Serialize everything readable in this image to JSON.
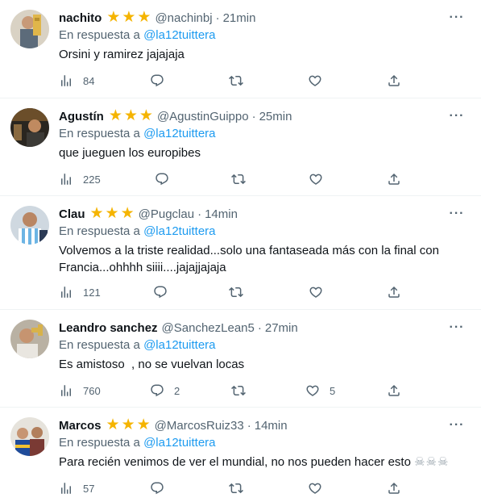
{
  "tweets": [
    {
      "name": "nachito",
      "stars": "★★★",
      "handle": "@nachinbj",
      "dot": "·",
      "time": "21min",
      "reply_prefix": "En respuesta a",
      "reply_to": "@la12tuittera",
      "text": "Orsini y ramirez jajajaja",
      "views": "84",
      "replies": "",
      "retweets": "",
      "likes": ""
    },
    {
      "name": "Agustín",
      "stars": "★★★",
      "handle": "@AgustinGuippo",
      "dot": "·",
      "time": "25min",
      "reply_prefix": "En respuesta a",
      "reply_to": "@la12tuittera",
      "text": "que jueguen los europibes",
      "views": "225",
      "replies": "",
      "retweets": "",
      "likes": ""
    },
    {
      "name": "Clau",
      "stars": "★★★",
      "handle": "@Pugclau",
      "dot": "·",
      "time": "14min",
      "reply_prefix": "En respuesta a",
      "reply_to": "@la12tuittera",
      "text": "Volvemos a la triste realidad...solo una fantaseada más con la final con Francia...ohhhh siiii....jajajjajaja",
      "views": "121",
      "replies": "",
      "retweets": "",
      "likes": ""
    },
    {
      "name": "Leandro sanchez",
      "stars": "",
      "handle": "@SanchezLean5",
      "dot": "·",
      "time": "27min",
      "reply_prefix": "En respuesta a",
      "reply_to": "@la12tuittera",
      "text": "Es amistoso  , no se vuelvan locas",
      "views": "760",
      "replies": "2",
      "retweets": "",
      "likes": "5"
    },
    {
      "name": "Marcos",
      "stars": "★★★",
      "handle": "@MarcosRuiz33",
      "dot": "·",
      "time": "14min",
      "reply_prefix": "En respuesta a",
      "reply_to": "@la12tuittera",
      "text": "Para recién venimos de ver el mundial, no nos pueden hacer esto",
      "emoji": "☠☠☠",
      "views": "57",
      "replies": "",
      "retweets": "",
      "likes": ""
    }
  ],
  "more_glyph": "···",
  "icons": {
    "views": "views-icon",
    "reply": "reply-icon",
    "retweet": "retweet-icon",
    "like": "like-icon",
    "share": "share-icon",
    "more": "more-icon"
  },
  "colors": {
    "text": "#0f1419",
    "secondary": "#536471",
    "link": "#1d9bf0",
    "star": "#f5b400",
    "divider": "#eff3f4"
  }
}
